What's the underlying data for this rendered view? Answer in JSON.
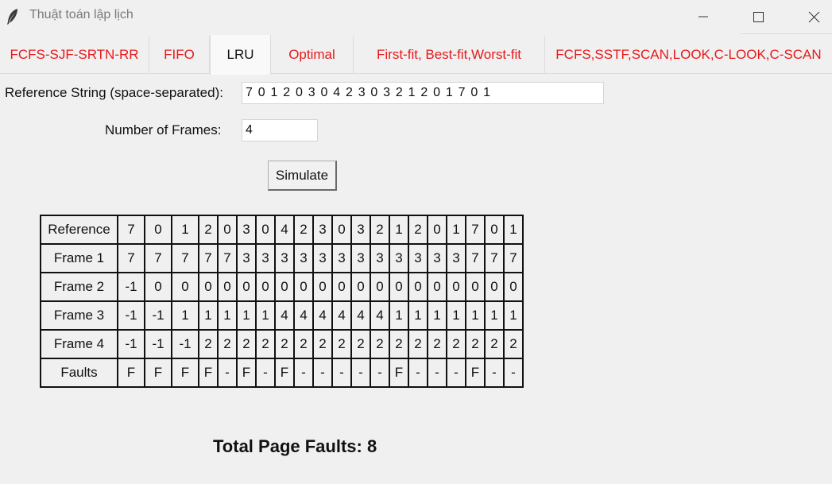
{
  "window": {
    "title": "Thuật toán lập lịch",
    "icon": "feather-icon",
    "controls": [
      "minimize-icon",
      "maximize-icon",
      "close-icon"
    ]
  },
  "tabs": [
    {
      "label": "FCFS-SJF-SRTN-RR"
    },
    {
      "label": "FIFO"
    },
    {
      "label": "LRU"
    },
    {
      "label": "Optimal"
    },
    {
      "label": "First-fit, Best-fit,Worst-fit"
    },
    {
      "label": "FCFS,SSTF,SCAN,LOOK,C-LOOK,C-SCAN"
    }
  ],
  "active_tab": "LRU",
  "colors": {
    "tab_text": "#e8191a",
    "active_tab_text": "#111111",
    "background": "#f0f0f0"
  },
  "form": {
    "reference_label": "Reference String (space-separated):",
    "reference_value": "7 0 1 2 0 3 0 4 2 3 0 3 2 1 2 0 1 7 0 1",
    "frames_label": "Number of Frames:",
    "frames_value": "4",
    "simulate_label": "Simulate"
  },
  "table": {
    "rows": [
      {
        "label": "Reference",
        "cells": [
          "7",
          "0",
          "1",
          "2",
          "0",
          "3",
          "0",
          "4",
          "2",
          "3",
          "0",
          "3",
          "2",
          "1",
          "2",
          "0",
          "1",
          "7",
          "0",
          "1"
        ]
      },
      {
        "label": "Frame 1",
        "cells": [
          "7",
          "7",
          "7",
          "7",
          "7",
          "3",
          "3",
          "3",
          "3",
          "3",
          "3",
          "3",
          "3",
          "3",
          "3",
          "3",
          "3",
          "7",
          "7",
          "7"
        ]
      },
      {
        "label": "Frame 2",
        "cells": [
          "-1",
          "0",
          "0",
          "0",
          "0",
          "0",
          "0",
          "0",
          "0",
          "0",
          "0",
          "0",
          "0",
          "0",
          "0",
          "0",
          "0",
          "0",
          "0",
          "0"
        ]
      },
      {
        "label": "Frame 3",
        "cells": [
          "-1",
          "-1",
          "1",
          "1",
          "1",
          "1",
          "1",
          "4",
          "4",
          "4",
          "4",
          "4",
          "4",
          "1",
          "1",
          "1",
          "1",
          "1",
          "1",
          "1"
        ]
      },
      {
        "label": "Frame 4",
        "cells": [
          "-1",
          "-1",
          "-1",
          "2",
          "2",
          "2",
          "2",
          "2",
          "2",
          "2",
          "2",
          "2",
          "2",
          "2",
          "2",
          "2",
          "2",
          "2",
          "2",
          "2"
        ]
      },
      {
        "label": "Faults",
        "cells": [
          "F",
          "F",
          "F",
          "F",
          "-",
          "F",
          "-",
          "F",
          "-",
          "-",
          "-",
          "-",
          "-",
          "F",
          "-",
          "-",
          "-",
          "F",
          "-",
          "-"
        ]
      }
    ]
  },
  "result": {
    "total_text": "Total Page Faults: 8"
  }
}
